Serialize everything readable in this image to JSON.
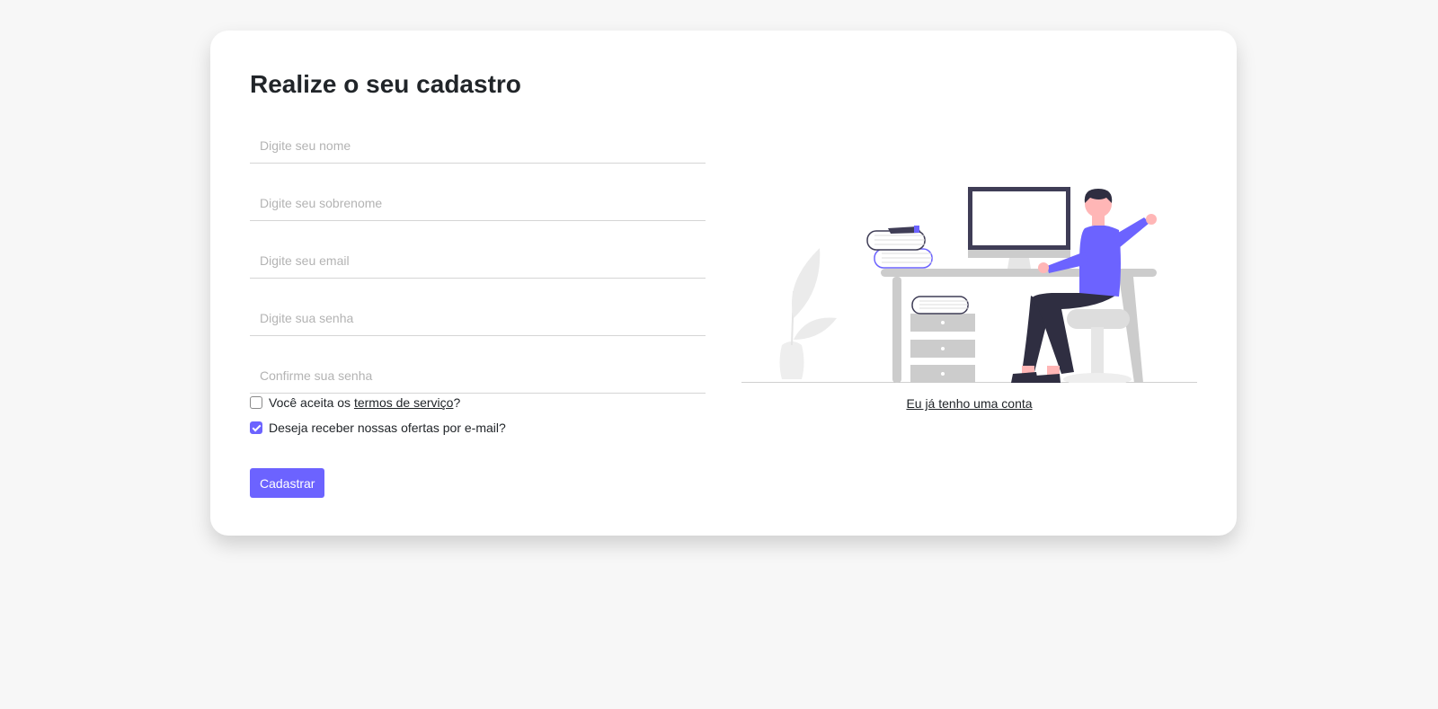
{
  "form": {
    "title": "Realize o seu cadastro",
    "fields": [
      {
        "placeholder": "Digite seu nome",
        "value": ""
      },
      {
        "placeholder": "Digite seu sobrenome",
        "value": ""
      },
      {
        "placeholder": "Digite seu email",
        "value": ""
      },
      {
        "placeholder": "Digite sua senha",
        "value": ""
      },
      {
        "placeholder": "Confirme sua senha",
        "value": ""
      }
    ],
    "terms": {
      "prefix": "Você aceita os ",
      "link": "termos de serviço",
      "suffix": "?",
      "checked": false
    },
    "offers": {
      "label": "Deseja receber nossas ofertas por e-mail?",
      "checked": true
    },
    "submit_label": "Cadastrar"
  },
  "side": {
    "illustration": "person-at-desk-illustration",
    "login_link": "Eu já tenho uma conta"
  },
  "colors": {
    "accent": "#6c63ff",
    "background": "#f7f7f7",
    "card": "#ffffff",
    "text": "#212529"
  }
}
